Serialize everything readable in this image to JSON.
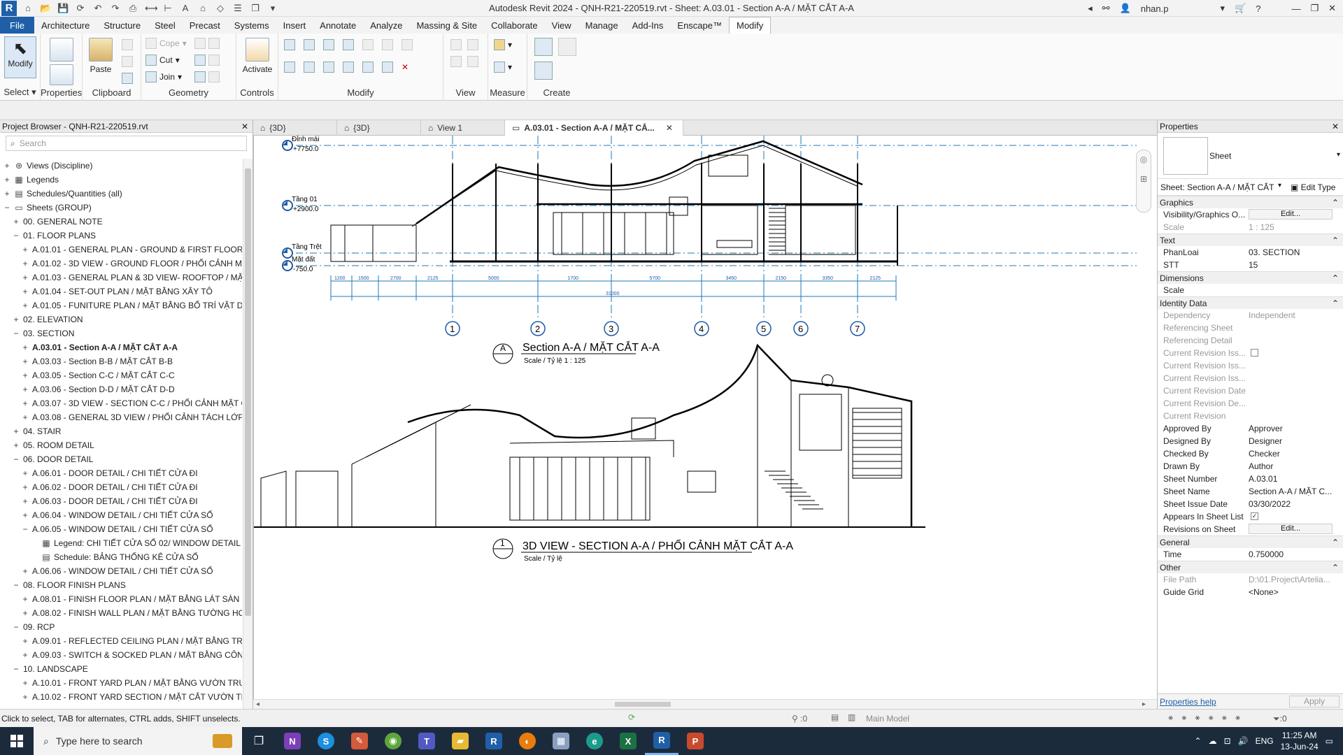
{
  "app": {
    "title": "Autodesk Revit 2024 - QNH-R21-220519.rvt - Sheet: A.03.01 - Section A-A / MẶT CẮT A-A",
    "logo": "R",
    "user": "nhan.p",
    "accent": "#1f5fa8"
  },
  "menu": [
    "File",
    "Architecture",
    "Structure",
    "Steel",
    "Precast",
    "Systems",
    "Insert",
    "Annotate",
    "Analyze",
    "Massing & Site",
    "Collaborate",
    "View",
    "Manage",
    "Add-Ins",
    "Enscape™",
    "Modify"
  ],
  "ribbon": {
    "select": {
      "modify": "Modify",
      "label": "Select"
    },
    "properties": {
      "label": "Properties"
    },
    "clipboard": {
      "paste": "Paste",
      "label": "Clipboard"
    },
    "geometry": {
      "cope": "Cope",
      "cut": "Cut",
      "join": "Join",
      "label": "Geometry"
    },
    "controls": {
      "activate": "Activate",
      "label": "Controls"
    },
    "modify": {
      "label": "Modify"
    },
    "view": {
      "label": "View"
    },
    "measure": {
      "label": "Measure"
    },
    "create": {
      "label": "Create"
    }
  },
  "project_browser": {
    "title": "Project Browser - QNH-R21-220519.rvt",
    "search_placeholder": "Search",
    "items": [
      {
        "level": 0,
        "toggle": "+",
        "icon": "views",
        "text": "Views (Discipline)"
      },
      {
        "level": 0,
        "toggle": "+",
        "icon": "legend",
        "text": "Legends"
      },
      {
        "level": 0,
        "toggle": "+",
        "icon": "schedule",
        "text": "Schedules/Quantities (all)"
      },
      {
        "level": 0,
        "toggle": "−",
        "icon": "sheet",
        "text": "Sheets (GROUP)"
      },
      {
        "level": 1,
        "toggle": "+",
        "text": "00. GENERAL NOTE"
      },
      {
        "level": 1,
        "toggle": "−",
        "text": "01. FLOOR PLANS"
      },
      {
        "level": 2,
        "toggle": "+",
        "text": "A.01.01 - GENERAL PLAN - GROUND & FIRST FLOOR /"
      },
      {
        "level": 2,
        "toggle": "+",
        "text": "A.01.02 - 3D VIEW - GROUND FLOOR / PHỐI CẢNH M"
      },
      {
        "level": 2,
        "toggle": "+",
        "text": "A.01.03 - GENERAL PLAN & 3D VIEW- ROOFTOP / MẶ"
      },
      {
        "level": 2,
        "toggle": "+",
        "text": "A.01.04 - SET-OUT PLAN / MẶT BẰNG XÂY TÔ"
      },
      {
        "level": 2,
        "toggle": "+",
        "text": "A.01.05 - FUNITURE PLAN / MẶT BẰNG BỐ TRÍ VẬT DỤ"
      },
      {
        "level": 1,
        "toggle": "+",
        "text": "02. ELEVATION"
      },
      {
        "level": 1,
        "toggle": "−",
        "text": "03. SECTION"
      },
      {
        "level": 2,
        "toggle": "+",
        "text": "A.03.01 - Section A-A / MẶT CẮT A-A",
        "bold": true
      },
      {
        "level": 2,
        "toggle": "+",
        "text": "A.03.03 - Section B-B / MẶT CẮT B-B"
      },
      {
        "level": 2,
        "toggle": "+",
        "text": "A.03.05 - Section C-C / MẶT CẮT C-C"
      },
      {
        "level": 2,
        "toggle": "+",
        "text": "A.03.06 - Section D-D / MẶT CẮT D-D"
      },
      {
        "level": 2,
        "toggle": "+",
        "text": "A.03.07 - 3D VIEW - SECTION C-C / PHỐI CẢNH MẶT C"
      },
      {
        "level": 2,
        "toggle": "+",
        "text": "A.03.08 - GENERAL 3D VIEW / PHỐI CẢNH TÁCH LỚP"
      },
      {
        "level": 1,
        "toggle": "+",
        "text": "04. STAIR"
      },
      {
        "level": 1,
        "toggle": "+",
        "text": "05. ROOM DETAIL"
      },
      {
        "level": 1,
        "toggle": "−",
        "text": "06. DOOR DETAIL"
      },
      {
        "level": 2,
        "toggle": "+",
        "text": "A.06.01 - DOOR DETAIL / CHI TIẾT CỬA ĐI"
      },
      {
        "level": 2,
        "toggle": "+",
        "text": "A.06.02 - DOOR DETAIL / CHI TIẾT CỬA ĐI"
      },
      {
        "level": 2,
        "toggle": "+",
        "text": "A.06.03 - DOOR DETAIL / CHI TIẾT CỬA ĐI"
      },
      {
        "level": 2,
        "toggle": "+",
        "text": "A.06.04 - WINDOW DETAIL / CHI TIẾT CỬA SỔ"
      },
      {
        "level": 2,
        "toggle": "−",
        "text": "A.06.05 - WINDOW DETAIL / CHI TIẾT CỬA SỔ"
      },
      {
        "level": 3,
        "toggle": "",
        "icon": "legend",
        "text": "Legend: CHI TIẾT CỬA SỔ 02/ WINDOW DETAIL"
      },
      {
        "level": 3,
        "toggle": "",
        "icon": "schedule",
        "text": "Schedule: BẢNG THỐNG KÊ CỬA SỔ"
      },
      {
        "level": 2,
        "toggle": "+",
        "text": "A.06.06 - WINDOW DETAIL / CHI TIẾT CỬA SỔ"
      },
      {
        "level": 1,
        "toggle": "−",
        "text": "08. FLOOR FINISH PLANS"
      },
      {
        "level": 2,
        "toggle": "+",
        "text": "A.08.01 - FINISH FLOOR PLAN / MẶT BẰNG LÁT SÀN H"
      },
      {
        "level": 2,
        "toggle": "+",
        "text": "A.08.02 - FINISH WALL PLAN / MẶT BẰNG TƯỜNG HC"
      },
      {
        "level": 1,
        "toggle": "−",
        "text": "09. RCP"
      },
      {
        "level": 2,
        "toggle": "+",
        "text": "A.09.01 - REFLECTED CEILING PLAN / MẶT BẰNG TRẦI"
      },
      {
        "level": 2,
        "toggle": "+",
        "text": "A.09.03 - SWITCH & SOCKED PLAN / MẶT BẰNG CÔN("
      },
      {
        "level": 1,
        "toggle": "−",
        "text": "10. LANDSCAPE"
      },
      {
        "level": 2,
        "toggle": "+",
        "text": "A.10.01 - FRONT YARD PLAN / MẶT BẰNG VƯỜN TRƯ"
      },
      {
        "level": 2,
        "toggle": "+",
        "text": "A.10.02 - FRONT YARD SECTION / MẶT CẮT VƯỜN TRI"
      }
    ]
  },
  "tabs": [
    {
      "label": "{3D}",
      "active": false
    },
    {
      "label": "{3D}",
      "active": false
    },
    {
      "label": "View 1",
      "active": false
    },
    {
      "label": "A.03.01 - Section A-A / MẶT CẮ...",
      "active": true
    }
  ],
  "drawing": {
    "levels": [
      {
        "name": "Đỉnh mái",
        "value": "+7750.0"
      },
      {
        "name": "Tầng 01",
        "value": "+2900.0"
      },
      {
        "name": "Tầng Trệt",
        "value": ""
      },
      {
        "name": "Mặt đất",
        "value": "-750.0"
      }
    ],
    "grids": [
      "1",
      "2",
      "3",
      "4",
      "5",
      "6",
      "7"
    ],
    "dims": [
      "1200",
      "1500",
      "2700",
      "2125",
      "5000",
      "1700",
      "5700",
      "3450",
      "2150",
      "3350",
      "2125"
    ],
    "total_dim": "31000",
    "section_title": "Section A-A / MẶT CẮT A-A",
    "section_mark": "A",
    "section_scale": "Scale / Tỷ lệ  1 : 125",
    "view3d_title": "3D VIEW - SECTION A-A / PHỐI CẢNH MẶT CẮT A-A",
    "view3d_mark": "1",
    "view3d_scale": "Scale / Tỷ lệ"
  },
  "properties": {
    "title": "Properties",
    "type_name": "Sheet",
    "selector": "Sheet: Section A-A / MẶT CẮT",
    "edit_type": "Edit Type",
    "rows": [
      {
        "kind": "cat",
        "k": "Graphics"
      },
      {
        "k": "Visibility/Graphics O...",
        "btn": "Edit..."
      },
      {
        "k": "Scale",
        "v": "1 : 125",
        "grey": true
      },
      {
        "kind": "cat",
        "k": "Text"
      },
      {
        "k": "PhanLoai",
        "v": "03. SECTION"
      },
      {
        "k": "STT",
        "v": "15"
      },
      {
        "kind": "cat",
        "k": "Dimensions"
      },
      {
        "k": "Scale",
        "v": ""
      },
      {
        "kind": "cat",
        "k": "Identity Data"
      },
      {
        "k": "Dependency",
        "v": "Independent",
        "grey": true
      },
      {
        "k": "Referencing Sheet",
        "v": "",
        "grey": true
      },
      {
        "k": "Referencing Detail",
        "v": "",
        "grey": true
      },
      {
        "k": "Current Revision Iss...",
        "check": "",
        "grey": true
      },
      {
        "k": "Current Revision Iss...",
        "v": "",
        "grey": true
      },
      {
        "k": "Current Revision Iss...",
        "v": "",
        "grey": true
      },
      {
        "k": "Current Revision Date",
        "v": "",
        "grey": true
      },
      {
        "k": "Current Revision De...",
        "v": "",
        "grey": true
      },
      {
        "k": "Current Revision",
        "v": "",
        "grey": true
      },
      {
        "k": "Approved By",
        "v": "Approver"
      },
      {
        "k": "Designed By",
        "v": "Designer"
      },
      {
        "k": "Checked By",
        "v": "Checker"
      },
      {
        "k": "Drawn By",
        "v": "Author"
      },
      {
        "k": "Sheet Number",
        "v": "A.03.01"
      },
      {
        "k": "Sheet Name",
        "v": "Section A-A / MẶT C..."
      },
      {
        "k": "Sheet Issue Date",
        "v": "03/30/2022"
      },
      {
        "k": "Appears In Sheet List",
        "check": "✓"
      },
      {
        "k": "Revisions on Sheet",
        "btn": "Edit..."
      },
      {
        "kind": "cat",
        "k": "General"
      },
      {
        "k": "Time",
        "v": "0.750000"
      },
      {
        "kind": "cat",
        "k": "Other"
      },
      {
        "k": "File Path",
        "v": "D:\\01.Project\\Artelia...",
        "grey": true
      },
      {
        "k": "Guide Grid",
        "v": "<None>"
      }
    ],
    "help": "Properties help",
    "apply": "Apply"
  },
  "status": {
    "hint": "Click to select, TAB for alternates, CTRL adds, SHIFT unselects.",
    "count": ":0",
    "model": "Main Model",
    "filter": ":0"
  },
  "taskbar": {
    "search_placeholder": "Type here to search",
    "lang": "ENG",
    "time": "11:25 AM",
    "date": "13-Jun-24"
  }
}
